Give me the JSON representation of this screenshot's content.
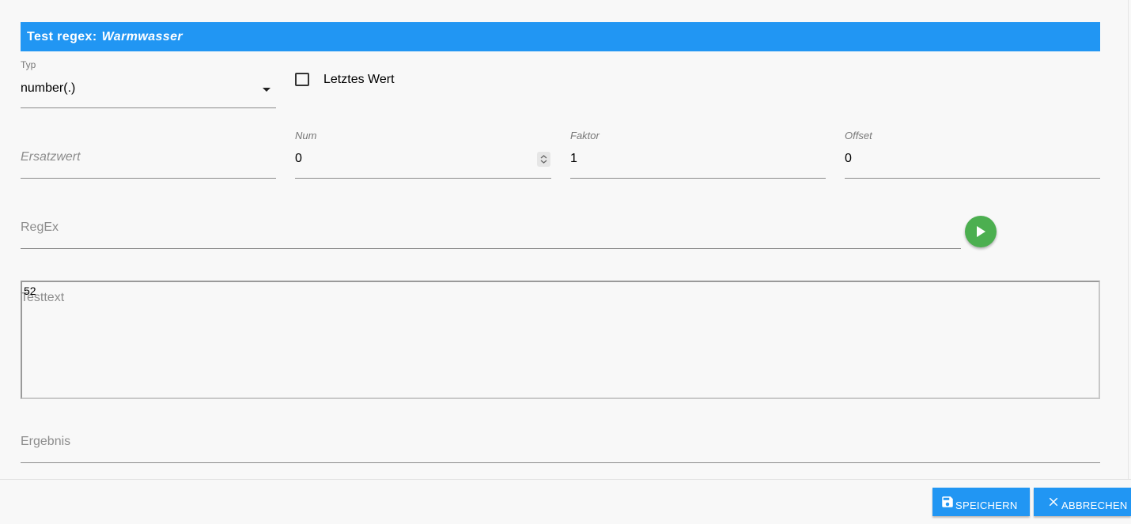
{
  "dialog": {
    "title_prefix": "Test regex:",
    "title_name": "Warmwasser"
  },
  "typ": {
    "label": "Typ",
    "value": "number(.)"
  },
  "letztes_wert": {
    "label": "Letztes Wert",
    "checked": false
  },
  "ersatzwert": {
    "placeholder": "Ersatzwert"
  },
  "num": {
    "label": "Num",
    "value": "0"
  },
  "faktor": {
    "label": "Faktor",
    "value": "1"
  },
  "offset": {
    "label": "Offset",
    "value": "0"
  },
  "regex": {
    "placeholder": "RegEx"
  },
  "testtext": {
    "placeholder": "Testtext",
    "value": "52"
  },
  "ergebnis": {
    "placeholder": "Ergebnis"
  },
  "buttons": {
    "save": "Speichern",
    "cancel": "Abbrechen"
  },
  "colors": {
    "accent": "#2196f3",
    "run": "#4caf50"
  },
  "icons": {
    "dropdown": "caret-down-icon",
    "stepper": "stepper-icon",
    "run": "play-icon",
    "save": "save-icon",
    "cancel": "close-icon"
  }
}
